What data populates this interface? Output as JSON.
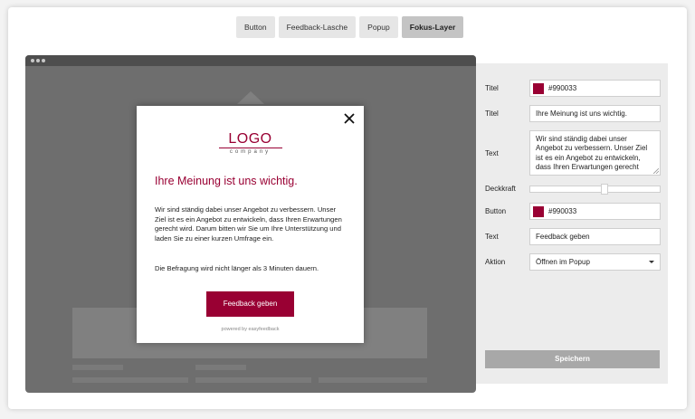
{
  "tabs": [
    {
      "label": "Button"
    },
    {
      "label": "Feedback-Lasche"
    },
    {
      "label": "Popup"
    },
    {
      "label": "Fokus-Layer"
    }
  ],
  "active_tab": "Fokus-Layer",
  "modal": {
    "logo_main": "LOGO",
    "logo_sub": "company",
    "title": "Ihre Meinung ist uns wichtig.",
    "body": "Wir sind ständig dabei unser Angebot zu verbessern. Unser Ziel ist es ein Angebot zu entwickeln, dass Ihren Erwartungen gerecht wird. Darum bitten wir Sie um Ihre Unterstützung und laden Sie zu einer kurzen Umfrage ein.",
    "note": "Die Befragung wird nicht länger als 3 Minuten dauern.",
    "button_label": "Feedback geben",
    "powered_by": "powered by easyfeedback"
  },
  "settings": {
    "title_color_label": "Titel",
    "title_color_value": "#990033",
    "title_text_label": "Titel",
    "title_text_value": "Ihre Meinung ist uns wichtig.",
    "text_label": "Text",
    "text_value": "Wir sind ständig dabei unser Angebot zu verbessern. Unser Ziel ist es ein Angebot zu entwickeln, dass Ihren Erwartungen gerecht",
    "opacity_label": "Deckkraft",
    "opacity_value": 0.58,
    "button_color_label": "Button",
    "button_color_value": "#990033",
    "button_text_label": "Text",
    "button_text_value": "Feedback geben",
    "action_label": "Aktion",
    "action_value": "Öffnen im Popup",
    "save_label": "Speichern"
  },
  "colors": {
    "accent": "#990033",
    "overlay": "#6e6e6e"
  }
}
